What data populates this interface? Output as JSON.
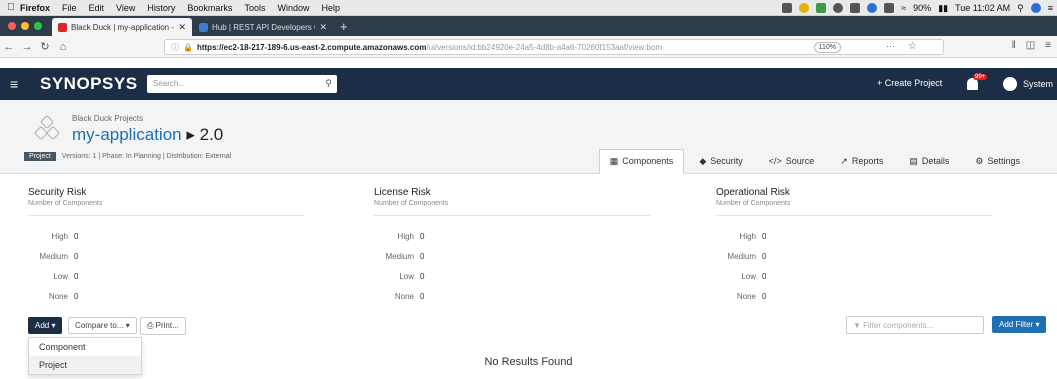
{
  "mac_menubar": {
    "app_name": "Firefox",
    "menus": [
      "File",
      "Edit",
      "View",
      "History",
      "Bookmarks",
      "Tools",
      "Window",
      "Help"
    ],
    "battery": "90%",
    "clock": "Tue 11:02 AM"
  },
  "browser": {
    "tabs": [
      {
        "title": "Black Duck | my-application - 2",
        "active": true
      },
      {
        "title": "Hub | REST API Developers G...",
        "active": false
      }
    ],
    "url_main": "https://ec2-18-217-189-6.us-east-2.compute.amazonaws.com",
    "url_rest": "/ui/versions/id:bb24920e-24a5-4d8b-a4a6-70260f153aaf/view:bom",
    "zoom": "110%",
    "page_actions": "···"
  },
  "app": {
    "logo": "SYNOPSYS",
    "search_placeholder": "Search...",
    "create_project": "Create Project",
    "notification_count": "99+",
    "user": "System"
  },
  "project": {
    "breadcrumb": "Black Duck Projects",
    "name": "my-application",
    "version": "2.0",
    "tag": "Project",
    "meta": "Versions: 1  |  Phase: In Planning  |  Distribution: External",
    "tabs": [
      {
        "label": "Components",
        "active": true
      },
      {
        "label": "Security",
        "active": false
      },
      {
        "label": "Source",
        "active": false
      },
      {
        "label": "Reports",
        "active": false
      },
      {
        "label": "Details",
        "active": false
      },
      {
        "label": "Settings",
        "active": false
      }
    ]
  },
  "risk_panels": [
    {
      "title": "Security Risk",
      "subtitle": "Number of Components",
      "rows": [
        {
          "label": "High",
          "value": "0"
        },
        {
          "label": "Medium",
          "value": "0"
        },
        {
          "label": "Low",
          "value": "0"
        },
        {
          "label": "None",
          "value": "0"
        }
      ]
    },
    {
      "title": "License Risk",
      "subtitle": "Number of Components",
      "rows": [
        {
          "label": "High",
          "value": "0"
        },
        {
          "label": "Medium",
          "value": "0"
        },
        {
          "label": "Low",
          "value": "0"
        },
        {
          "label": "None",
          "value": "0"
        }
      ]
    },
    {
      "title": "Operational Risk",
      "subtitle": "Number of Components",
      "rows": [
        {
          "label": "High",
          "value": "0"
        },
        {
          "label": "Medium",
          "value": "0"
        },
        {
          "label": "Low",
          "value": "0"
        },
        {
          "label": "None",
          "value": "0"
        }
      ]
    }
  ],
  "toolbar": {
    "add": "Add",
    "compare": "Compare to...",
    "print": "Print...",
    "filter_placeholder": "Filter components...",
    "add_filter": "Add Filter"
  },
  "add_menu": {
    "items": [
      "Component",
      "Project"
    ]
  },
  "empty_message": "No Results Found",
  "colors": {
    "header_bg": "#1c2e45",
    "link_blue": "#1f6fb2",
    "add_filter_bg": "#1f6fb2",
    "badge_red": "#d8262b"
  }
}
